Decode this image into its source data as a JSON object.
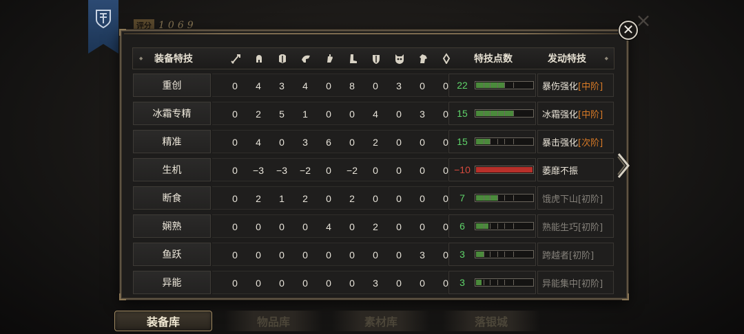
{
  "top": {
    "score_label": "评分",
    "score_value": "1069",
    "banner_icon": "guild-crest-icon",
    "close_icon": "close-icon"
  },
  "header": {
    "col_skill": "装备特技",
    "col_points": "特技点数",
    "col_effect": "发动特技",
    "equip_slot_icons": [
      "sword-icon",
      "helmet-icon",
      "chest-armor-icon",
      "shoulder-icon",
      "glove-icon",
      "boots-icon",
      "shield-icon",
      "demon-mask-icon",
      "horse-icon",
      "amulet-icon"
    ]
  },
  "rows": [
    {
      "name": "重创",
      "values": [
        "0",
        "4",
        "3",
        "4",
        "0",
        "8",
        "0",
        "3",
        "0",
        "0"
      ],
      "points": "22",
      "fill": 0.5,
      "effect": "暴伤强化",
      "tier": "[中阶]",
      "active": true
    },
    {
      "name": "冰霜专精",
      "values": [
        "0",
        "2",
        "5",
        "1",
        "0",
        "0",
        "4",
        "0",
        "3",
        "0"
      ],
      "points": "15",
      "fill": 0.66,
      "effect": "冰霜强化",
      "tier": "[中阶]",
      "active": true
    },
    {
      "name": "精准",
      "values": [
        "0",
        "4",
        "0",
        "3",
        "6",
        "0",
        "2",
        "0",
        "0",
        "0"
      ],
      "points": "15",
      "fill": 0.25,
      "effect": "暴击强化",
      "tier": "[次阶]",
      "active": true
    },
    {
      "name": "生机",
      "values": [
        "0",
        "−3",
        "−3",
        "−2",
        "0",
        "−2",
        "0",
        "0",
        "0",
        "0"
      ],
      "points": "−10",
      "fill": 1.0,
      "negative": true,
      "effect": "萎靡不振",
      "tier": "",
      "active": true
    },
    {
      "name": "断食",
      "values": [
        "0",
        "2",
        "1",
        "2",
        "0",
        "2",
        "0",
        "0",
        "0",
        "0"
      ],
      "points": "7",
      "fill": 0.38,
      "effect": "饿虎下山",
      "tier": "[初阶]",
      "active": false
    },
    {
      "name": "娴熟",
      "values": [
        "0",
        "0",
        "0",
        "0",
        "4",
        "0",
        "2",
        "0",
        "0",
        "0"
      ],
      "points": "6",
      "fill": 0.22,
      "effect": "熟能生巧",
      "tier": "[初阶]",
      "active": false
    },
    {
      "name": "鱼跃",
      "values": [
        "0",
        "0",
        "0",
        "0",
        "0",
        "0",
        "0",
        "0",
        "3",
        "0"
      ],
      "points": "3",
      "fill": 0.14,
      "effect": "跨越者",
      "tier": "[初阶]",
      "active": false
    },
    {
      "name": "异能",
      "values": [
        "0",
        "0",
        "0",
        "0",
        "0",
        "0",
        "3",
        "0",
        "0",
        "0"
      ],
      "points": "3",
      "fill": 0.1,
      "effect": "异能集中",
      "tier": "[初阶]",
      "active": false
    }
  ],
  "tabs": [
    "装备库",
    "物品库",
    "素材库",
    "落银城"
  ],
  "active_tab": 0,
  "colors": {
    "positive_points": "#5fd46a",
    "negative_points": "#d84b3e",
    "tier_accent": "#d87a26",
    "bar_fill": "#4b8a3c",
    "bar_negative": "#b8302a"
  }
}
